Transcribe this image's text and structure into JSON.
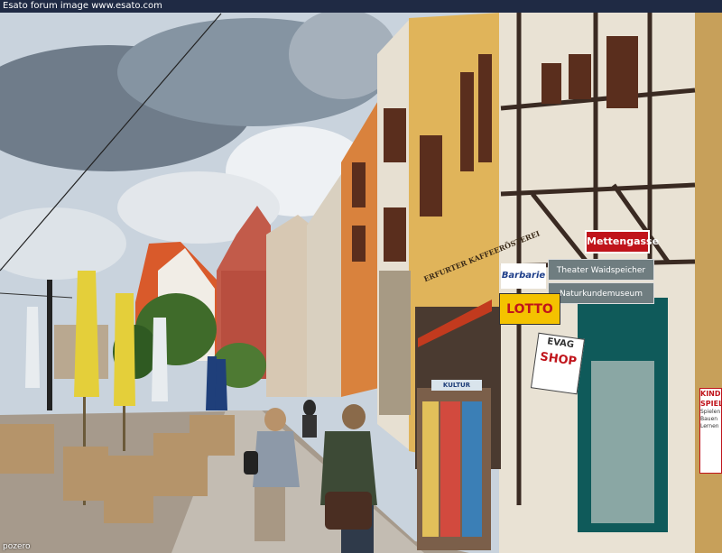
{
  "watermark": "Esato forum image www.esato.com",
  "credit": "pozero",
  "signs": {
    "mettengasse": "Mettengasse",
    "theater": "Theater Waidspeicher",
    "naturkunde": "Naturkundemuseum",
    "barbarie": "Barbarie",
    "lotto": "LOTTO",
    "kaffee": "ERFURTER KAFFEERÖSTEREI",
    "evag": "EVAG",
    "shop": "SHOP",
    "kultur": "KULTUR",
    "kinder_1": "KINDER",
    "kinder_2": "SPIEL",
    "kinder_3": "Spielen Bauen Lernen"
  },
  "colors": {
    "sky": "#c9d3dd",
    "cloud": "#eef1f4",
    "orange_facade": "#d9823d",
    "yellow_facade": "#e0b45a",
    "half_timber": "#3a2a22",
    "plaster": "#e7e0d2",
    "pavement": "#a69a8c",
    "lotto_yellow": "#f4c200",
    "sign_red": "#c0141b"
  }
}
